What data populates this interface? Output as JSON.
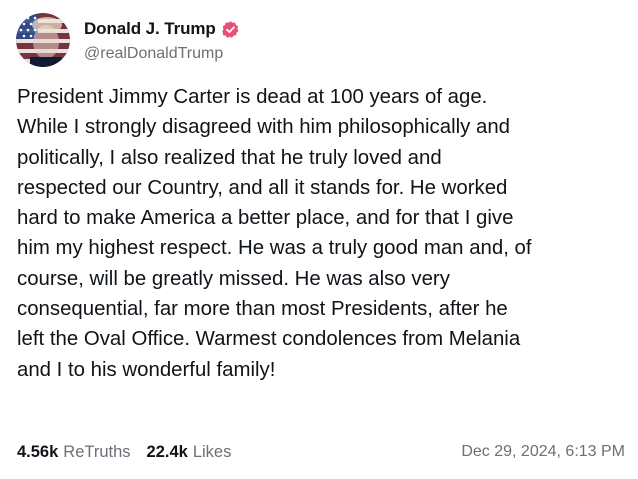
{
  "author": {
    "display_name": "Donald J. Trump",
    "handle": "@realDonaldTrump",
    "verified_icon": "verified-badge-icon",
    "verified_color": "#e8507a",
    "avatar_icon": "profile-avatar"
  },
  "post": {
    "text": "President Jimmy Carter is dead at 100 years of age.\nWhile I strongly disagreed with him philosophically and\npolitically, I also realized that he truly loved and\nrespected our Country, and all it stands for. He worked\nhard to make America a better place, and for that I give\nhim my highest respect. He was a truly good man and, of\ncourse, will be greatly missed. He was also very\nconsequential, far more than most Presidents, after he\nleft the Oval Office. Warmest condolences from Melania\nand I to his wonderful family!"
  },
  "stats": {
    "retruths_count": "4.56k",
    "retruths_label": "ReTruths",
    "likes_count": "22.4k",
    "likes_label": "Likes"
  },
  "timestamp": "Dec 29, 2024, 6:13 PM",
  "colors": {
    "text": "#0f1419",
    "muted": "#6b6f76",
    "background": "#ffffff"
  }
}
